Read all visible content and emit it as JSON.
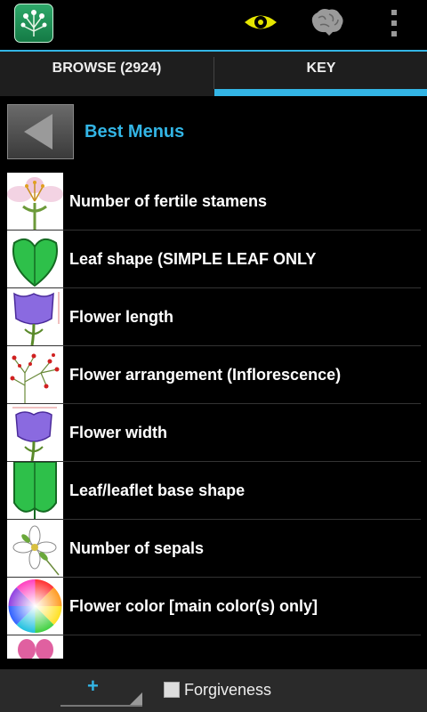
{
  "actionbar": {
    "app_icon": "flower-app-icon",
    "actions": [
      "eye-icon",
      "brain-icon",
      "overflow-menu-icon"
    ]
  },
  "tabs": {
    "browse": "BROWSE (2924)",
    "key": "KEY",
    "selected": "KEY",
    "accent_color": "#33b5e5"
  },
  "header": {
    "back_icon": "back-arrow-icon",
    "title": "Best Menus"
  },
  "list": {
    "items": [
      {
        "label": "Number of fertile stamens",
        "icon": "stamens-thumbnail"
      },
      {
        "label": "Leaf shape (SIMPLE LEAF ONLY",
        "icon": "leaf-shape-thumbnail"
      },
      {
        "label": "Flower length",
        "icon": "flower-length-thumbnail"
      },
      {
        "label": "Flower arrangement (Inflorescence)",
        "icon": "inflorescence-thumbnail"
      },
      {
        "label": "Flower width",
        "icon": "flower-width-thumbnail"
      },
      {
        "label": "Leaf/leaflet base shape",
        "icon": "leaf-base-thumbnail"
      },
      {
        "label": "Number of sepals",
        "icon": "sepals-thumbnail"
      },
      {
        "label": "Flower color [main color(s) only]",
        "icon": "color-wheel-thumbnail"
      }
    ]
  },
  "bottombar": {
    "add_label": "+",
    "forgiveness_label": "Forgiveness",
    "forgiveness_checked": false
  }
}
